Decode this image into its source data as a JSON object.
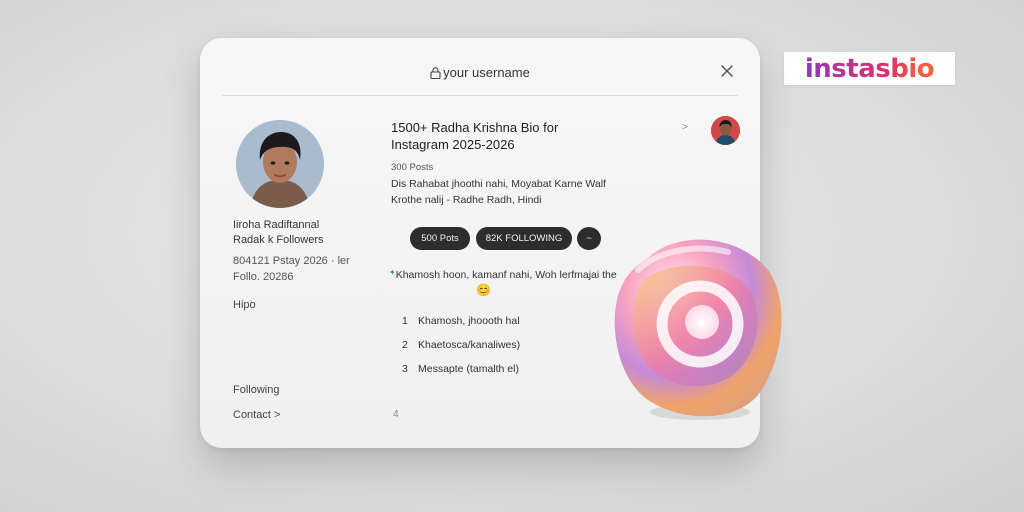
{
  "brand": {
    "name": "instasbio"
  },
  "header": {
    "username": "your username"
  },
  "profile": {
    "name": "Iiroha Radiftannal",
    "followers": "Radak k Followers",
    "meta_line1": "804121 Pstay 2026 · ler",
    "meta_line2": "Follo. 20286",
    "tag": "Hipo"
  },
  "sidebar": {
    "following": "Following",
    "contact": "Contact >"
  },
  "post": {
    "title_line1": "1500+ Radha Krishna Bio for",
    "title_line2": "Instagram  2025-2026",
    "posts_count": "300 Posts",
    "bio_line1": "Dis Rahabat jhoothi nahi, Moyabat Karne Walf",
    "bio_line2": "Krothe nalij - Radhe Radh, Hindi",
    "quote": "Khamosh hoon, kamanf nahi, Woh lerfmajai the",
    "emoji": "😊",
    "footer_glyph": "4",
    "arrow_glyph": ">"
  },
  "stats": {
    "posts_btn": "500 Pots",
    "following_btn": "82K FOLLOWING",
    "more_btn": "~"
  },
  "list": [
    {
      "num": "1",
      "text": "Khamosh, jhoooth hal"
    },
    {
      "num": "2",
      "text": "Khaetosca/kanaliwes)"
    },
    {
      "num": "3",
      "text": "Messapte  (tamalth el)"
    }
  ],
  "colors": {
    "pill_bg": "#2d2d2d",
    "brand_gradient_start": "#8a3ab9",
    "brand_gradient_end": "#f56040"
  }
}
